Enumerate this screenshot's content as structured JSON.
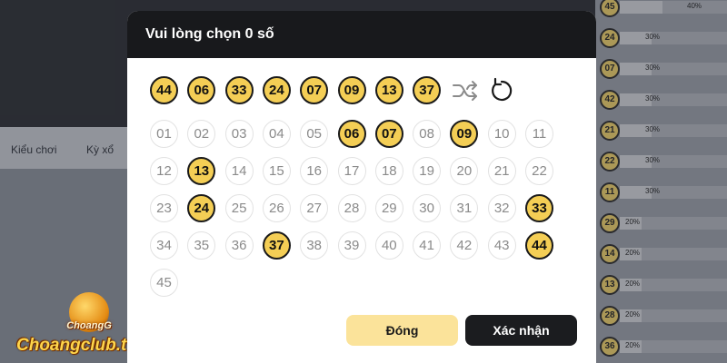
{
  "background": {
    "tabs": [
      "Kiểu chơi",
      "Kỳ xổ"
    ]
  },
  "stats_panel": {
    "rows": [
      {
        "number": "45",
        "percent": "40%",
        "fill": 0.4
      },
      {
        "number": "24",
        "percent": "30%",
        "fill": 0.3
      },
      {
        "number": "07",
        "percent": "30%",
        "fill": 0.3
      },
      {
        "number": "42",
        "percent": "30%",
        "fill": 0.3
      },
      {
        "number": "21",
        "percent": "30%",
        "fill": 0.3
      },
      {
        "number": "22",
        "percent": "30%",
        "fill": 0.3
      },
      {
        "number": "11",
        "percent": "30%",
        "fill": 0.3
      },
      {
        "number": "29",
        "percent": "20%",
        "fill": 0.2
      },
      {
        "number": "14",
        "percent": "20%",
        "fill": 0.2
      },
      {
        "number": "13",
        "percent": "20%",
        "fill": 0.2
      },
      {
        "number": "28",
        "percent": "20%",
        "fill": 0.2
      },
      {
        "number": "36",
        "percent": "20%",
        "fill": 0.2
      }
    ]
  },
  "modal": {
    "title": "Vui lòng chọn 0 số",
    "quick_numbers": [
      "44",
      "06",
      "33",
      "24",
      "07",
      "09",
      "13",
      "37"
    ],
    "shuffle_icon": "shuffle-icon",
    "reset_icon": "refresh-icon",
    "grid_numbers": [
      "01",
      "02",
      "03",
      "04",
      "05",
      "06",
      "07",
      "08",
      "09",
      "10",
      "11",
      "12",
      "13",
      "14",
      "15",
      "16",
      "17",
      "18",
      "19",
      "20",
      "21",
      "22",
      "23",
      "24",
      "25",
      "26",
      "27",
      "28",
      "29",
      "30",
      "31",
      "32",
      "33",
      "34",
      "35",
      "36",
      "37",
      "38",
      "39",
      "40",
      "41",
      "42",
      "43",
      "44",
      "45"
    ],
    "highlighted": [
      "06",
      "07",
      "09",
      "13",
      "24",
      "33",
      "37",
      "44"
    ],
    "close_label": "Đóng",
    "confirm_label": "Xác nhận",
    "colors": {
      "highlight": "#f4ce55",
      "header": "#18191c",
      "close_bg": "#fbe39a"
    }
  },
  "watermark": {
    "small_text": "ChoangG",
    "site_text": "Choangclub.tv"
  }
}
